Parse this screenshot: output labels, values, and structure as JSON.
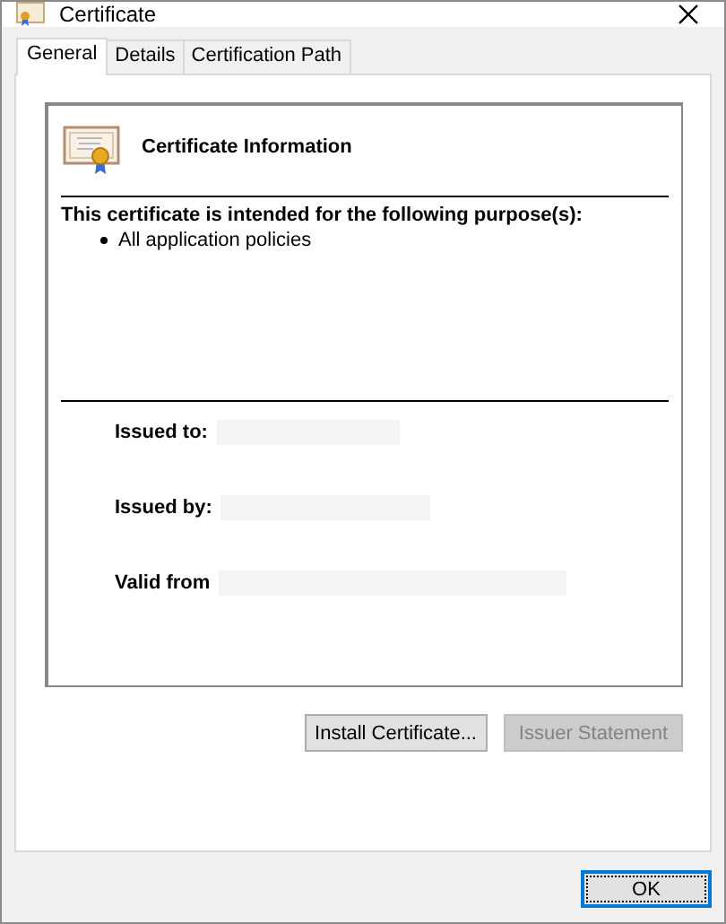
{
  "window": {
    "title": "Certificate"
  },
  "tabs": [
    {
      "label": "General",
      "selected": true
    },
    {
      "label": "Details",
      "selected": false
    },
    {
      "label": "Certification Path",
      "selected": false
    }
  ],
  "info": {
    "heading": "Certificate Information",
    "purpose_heading": "This certificate is intended for the following purpose(s):",
    "purposes": [
      "All application policies"
    ],
    "fields": [
      {
        "label": "Issued to:",
        "kind": "short"
      },
      {
        "label": "Issued by:",
        "kind": "medium"
      },
      {
        "label": "Valid from",
        "kind": "long"
      }
    ]
  },
  "actions": [
    {
      "label": "Install Certificate...",
      "disabled": false
    },
    {
      "label": "Issuer Statement",
      "disabled": true
    }
  ],
  "footer": {
    "ok": "OK"
  }
}
